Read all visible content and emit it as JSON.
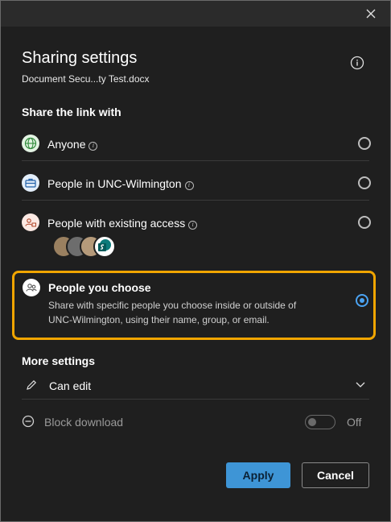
{
  "dialog": {
    "title": "Sharing settings",
    "filename": "Document Secu...ty Test.docx"
  },
  "share": {
    "heading": "Share the link with",
    "options": [
      {
        "label": "Anyone",
        "icon": "globe-icon",
        "selected": false
      },
      {
        "label": "People in UNC-Wilmington",
        "icon": "briefcase-icon",
        "selected": false
      },
      {
        "label": "People with existing access",
        "icon": "people-lock-icon",
        "selected": false
      },
      {
        "label": "People you choose",
        "icon": "people-icon",
        "selected": true,
        "description": "Share with specific people you choose inside or outside of UNC-Wilmington, using their name, group, or email."
      }
    ]
  },
  "more": {
    "heading": "More settings",
    "permission": "Can edit",
    "block_download_label": "Block download",
    "block_download_state": "Off"
  },
  "buttons": {
    "apply": "Apply",
    "cancel": "Cancel"
  },
  "colors": {
    "accent": "#3e95d6",
    "highlight": "#f0a500",
    "radio_selected": "#4ba3f2"
  }
}
